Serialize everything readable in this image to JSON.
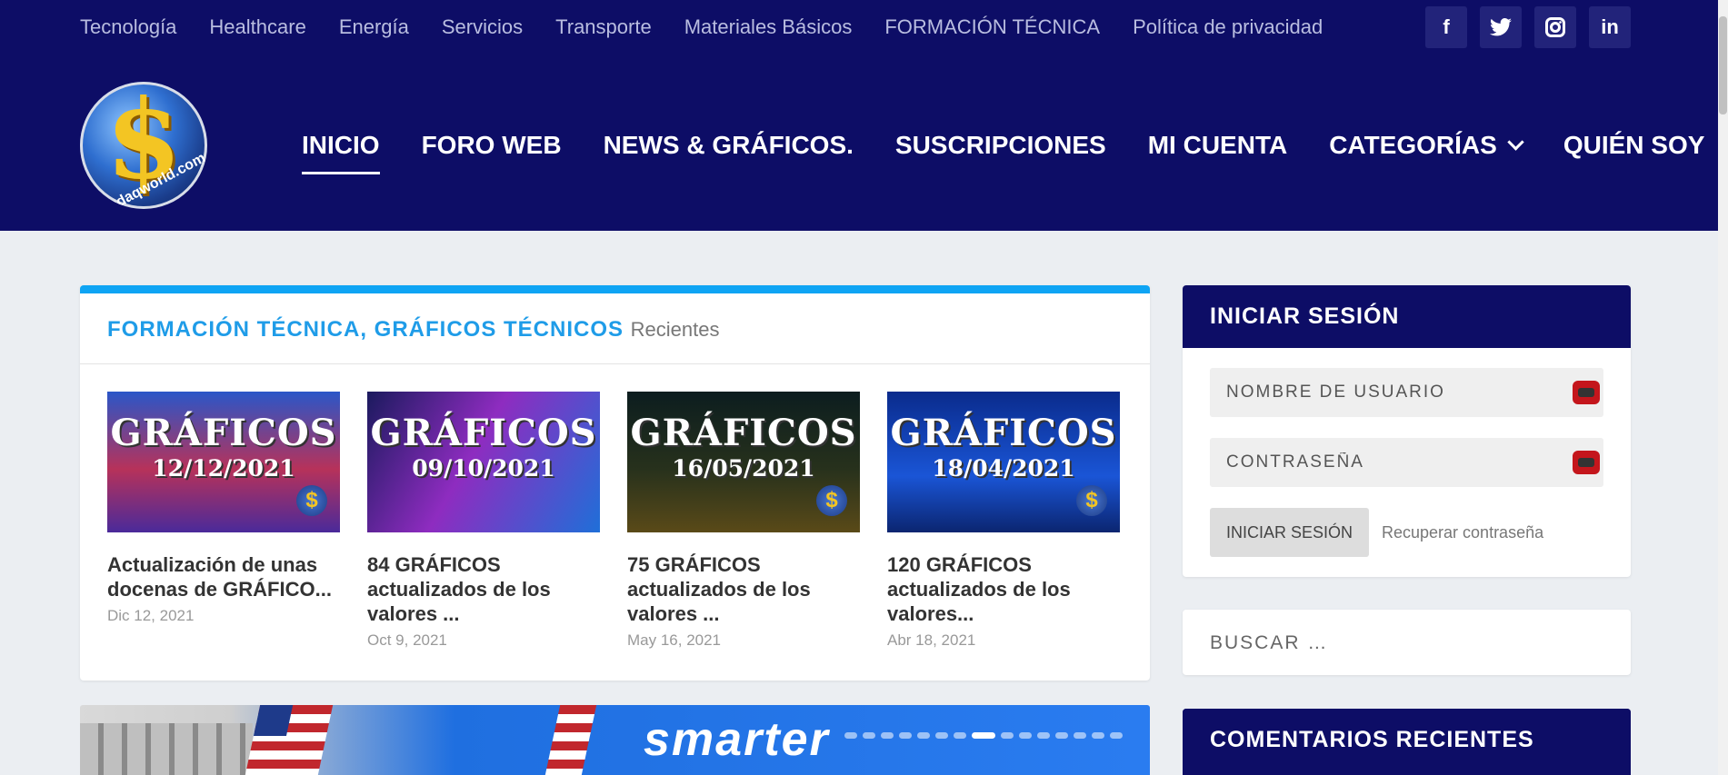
{
  "topnav": [
    "Tecnología",
    "Healthcare",
    "Energía",
    "Servicios",
    "Transporte",
    "Materiales Básicos",
    "FORMACIÓN TÉCNICA",
    "Política de privacidad"
  ],
  "social": [
    {
      "label": "f",
      "icon": "facebook-icon"
    },
    {
      "label": "t",
      "icon": "twitter-icon"
    },
    {
      "label": "ig",
      "icon": "instagram-icon"
    },
    {
      "label": "in",
      "icon": "linkedin-icon"
    }
  ],
  "logo": {
    "text": "nasdaqworld.com"
  },
  "mainnav": [
    {
      "label": "INICIO",
      "active": true
    },
    {
      "label": "FORO WEB"
    },
    {
      "label": "NEWS & GRÁFICOS."
    },
    {
      "label": "SUSCRIPCIONES"
    },
    {
      "label": "MI CUENTA"
    },
    {
      "label": "CATEGORÍAS",
      "dropdown": true
    },
    {
      "label": "QUIÉN SOY"
    }
  ],
  "section": {
    "title": "FORMACIÓN TÉCNICA, GRÁFICOS TÉCNICOS",
    "subtitle": "Recientes"
  },
  "posts": [
    {
      "thumb_title": "GRÁFICOS",
      "thumb_date": "12/12/2021",
      "title": "Actualización de unas docenas de GRÁFICO...",
      "date": "Dic 12, 2021"
    },
    {
      "thumb_title": "GRÁFICOS",
      "thumb_date": "09/10/2021",
      "title": "84 GRÁFICOS actualizados de los valores ...",
      "date": "Oct 9, 2021"
    },
    {
      "thumb_title": "GRÁFICOS",
      "thumb_date": "16/05/2021",
      "title": "75 GRÁFICOS actualizados de los valores ...",
      "date": "May 16, 2021"
    },
    {
      "thumb_title": "GRÁFICOS",
      "thumb_date": "18/04/2021",
      "title": "120 GRÁFICOS actualizados de los valores...",
      "date": "Abr 18, 2021"
    }
  ],
  "hero": {
    "banner_text": "smarter"
  },
  "login": {
    "title": "INICIAR SESIÓN",
    "username_placeholder": "NOMBRE DE USUARIO",
    "password_placeholder": "CONTRASEÑA",
    "button": "INICIAR SESIÓN",
    "recover": "Recuperar contraseña"
  },
  "search": {
    "placeholder": "BUSCAR …"
  },
  "comments": {
    "title": "COMENTARIOS RECIENTES"
  },
  "colors": {
    "header": "#0d0d66",
    "accent": "#1f9ce8",
    "card_top": "#0ea4f4"
  }
}
